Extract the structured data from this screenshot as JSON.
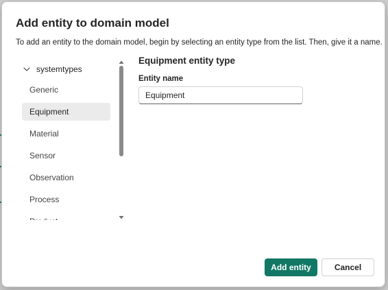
{
  "dialog": {
    "title": "Add entity to domain model",
    "description": "To add an entity to the domain model, begin by selecting an entity type from the list. Then, give it a name."
  },
  "tree": {
    "root_label": "systemtypes",
    "root_expanded": true,
    "items": [
      {
        "label": "Generic",
        "selected": false
      },
      {
        "label": "Equipment",
        "selected": true
      },
      {
        "label": "Material",
        "selected": false
      },
      {
        "label": "Sensor",
        "selected": false
      },
      {
        "label": "Observation",
        "selected": false
      },
      {
        "label": "Process",
        "selected": false
      },
      {
        "label": "Product",
        "selected": false
      }
    ]
  },
  "form": {
    "section_heading": "Equipment entity type",
    "entity_name_label": "Entity name",
    "entity_name_value": "Equipment"
  },
  "buttons": {
    "add_label": "Add entity",
    "cancel_label": "Cancel"
  },
  "icons": {
    "tree_toggle": "chevron-down-icon",
    "scroll_up": "caret-up-icon",
    "scroll_down": "caret-down-icon"
  },
  "colors": {
    "primary": "#117865",
    "selected_row": "#ebebeb",
    "text": "#242424"
  }
}
